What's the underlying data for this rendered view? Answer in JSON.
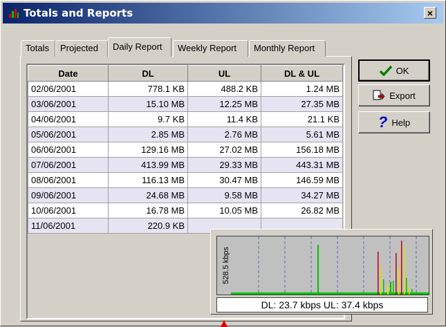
{
  "window": {
    "title": "Totals and Reports",
    "close_label": "×"
  },
  "tabs": [
    {
      "label": "Totals"
    },
    {
      "label": "Projected"
    },
    {
      "label": "Daily Report"
    },
    {
      "label": "Weekly Report"
    },
    {
      "label": "Monthly Report"
    }
  ],
  "active_tab": "Daily Report",
  "table": {
    "headers": [
      "Date",
      "DL",
      "UL",
      "DL & UL"
    ],
    "rows": [
      [
        "02/06/2001",
        "778.1 KB",
        "488.2 KB",
        "1.24 MB"
      ],
      [
        "03/06/2001",
        "15.10 MB",
        "12.25 MB",
        "27.35 MB"
      ],
      [
        "04/06/2001",
        "9.7 KB",
        "11.4 KB",
        "21.1 KB"
      ],
      [
        "05/06/2001",
        "2.85 MB",
        "2.76 MB",
        "5.61 MB"
      ],
      [
        "06/06/2001",
        "129.16 MB",
        "27.02 MB",
        "156.18 MB"
      ],
      [
        "07/06/2001",
        "413.99 MB",
        "29.33 MB",
        "443.31 MB"
      ],
      [
        "08/06/2001",
        "116.13 MB",
        "30.47 MB",
        "146.59 MB"
      ],
      [
        "09/06/2001",
        "24.68 MB",
        "9.58 MB",
        "34.27 MB"
      ],
      [
        "10/06/2001",
        "16.78 MB",
        "10.05 MB",
        "26.82 MB"
      ],
      [
        "11/06/2001",
        "220.9 KB",
        "",
        ""
      ]
    ]
  },
  "buttons": {
    "ok": "OK",
    "export": "Export",
    "help": "Help"
  },
  "graph": {
    "ylabel": "528.5 kbps",
    "status": "DL: 23.7 kbps  UL: 37.4 kbps",
    "colors": {
      "download": "#00c000",
      "upload": "#e0e000",
      "peak": "#c00000",
      "gridline": "#5070c0"
    }
  }
}
